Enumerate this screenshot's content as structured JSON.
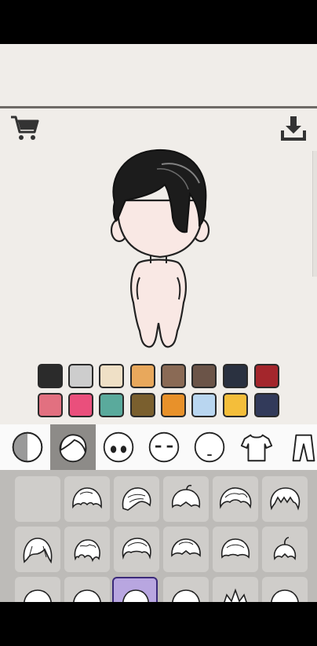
{
  "app": {
    "toolbar": {
      "cart_icon": "shopping-cart-icon",
      "download_icon": "download-icon"
    },
    "avatar": {
      "hair_color": "#1c1c1c",
      "skin_color": "#f9e8e4"
    },
    "palette": {
      "colors": [
        "#2b2b2b",
        "#cdcdcd",
        "#efe0c6",
        "#e8a85c",
        "#8a6a55",
        "#6b5448",
        "#2a3140",
        "#a4262c",
        "#e27080",
        "#ea4f7c",
        "#5aaa9c",
        "#7a5f2e",
        "#e8912a",
        "#b9d6f0",
        "#f4be3a",
        "#323a5a"
      ]
    },
    "categories": [
      {
        "name": "skin-tone",
        "icon": "half-circle-icon",
        "selected": false
      },
      {
        "name": "hair",
        "icon": "hair-icon",
        "selected": true
      },
      {
        "name": "eyes",
        "icon": "eyes-icon",
        "selected": false
      },
      {
        "name": "eyebrows",
        "icon": "eyebrows-icon",
        "selected": false
      },
      {
        "name": "mouth",
        "icon": "mouth-icon",
        "selected": false
      },
      {
        "name": "top",
        "icon": "tshirt-icon",
        "selected": false
      },
      {
        "name": "bottom",
        "icon": "pants-icon",
        "selected": false
      }
    ],
    "hair_styles": {
      "selected_index": 15,
      "count": 19
    }
  }
}
